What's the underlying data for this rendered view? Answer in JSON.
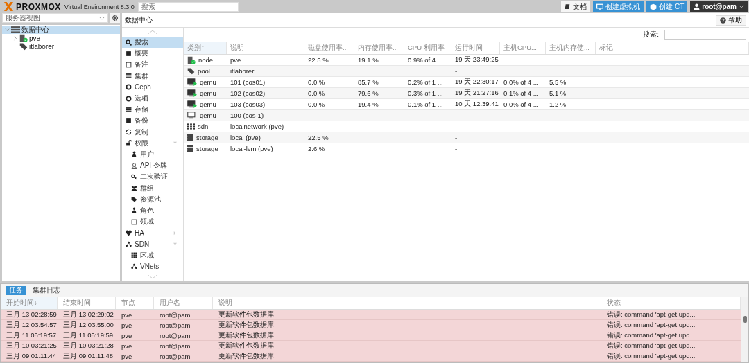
{
  "topbar": {
    "logo": "PROXMOX",
    "product": "Virtual Environment 8.3.0",
    "search": {
      "placeholder": "搜索"
    },
    "buttons": [
      {
        "label": "文档",
        "kind": "docs"
      },
      {
        "label": "创建虚拟机",
        "kind": "vm"
      },
      {
        "label": "创建 CT",
        "kind": "ct"
      },
      {
        "label": "root@pam",
        "kind": "user"
      }
    ]
  },
  "sidebar": {
    "view": "服务器视图",
    "tree": [
      {
        "label": "数据中心",
        "kind": "datacenter",
        "selected": true,
        "expanded": true,
        "children": [
          {
            "label": "pve",
            "kind": "node",
            "selected": false,
            "expanded": false
          },
          {
            "label": "itlaborer",
            "kind": "pool",
            "selected": false
          }
        ]
      }
    ]
  },
  "main": {
    "title": "数据中心",
    "help": "帮助",
    "nav": [
      {
        "label": "搜索",
        "selected": true
      },
      {
        "label": "概要",
        "selected": false
      },
      {
        "label": "备注",
        "selected": false
      },
      {
        "label": "集群",
        "selected": false
      },
      {
        "label": "Ceph",
        "selected": false
      },
      {
        "label": "选项",
        "selected": false
      },
      {
        "label": "存储",
        "selected": false
      },
      {
        "label": "备份",
        "selected": false
      },
      {
        "label": "复制",
        "selected": false
      },
      {
        "label": "权限",
        "selected": false,
        "expanded": true,
        "children": [
          {
            "label": "用户",
            "selected": false
          },
          {
            "label": "API 令牌",
            "selected": false
          },
          {
            "label": "二次验证",
            "selected": false
          },
          {
            "label": "群组",
            "selected": false
          },
          {
            "label": "资源池",
            "selected": false
          },
          {
            "label": "角色",
            "selected": false
          },
          {
            "label": "领域",
            "selected": false
          }
        ]
      },
      {
        "label": "HA",
        "selected": false,
        "expanded": false
      },
      {
        "label": "SDN",
        "selected": false,
        "expanded": true,
        "children": [
          {
            "label": "区域",
            "selected": false
          },
          {
            "label": "VNets",
            "selected": false
          }
        ]
      }
    ],
    "search_label": "搜索:",
    "table": {
      "columns": [
        {
          "label": "类别",
          "sort_mark": "↑"
        },
        {
          "label": "说明"
        },
        {
          "label": "磁盘使用率..."
        },
        {
          "label": "内存使用率..."
        },
        {
          "label": "CPU 利用率"
        },
        {
          "label": "运行时间"
        },
        {
          "label": "主机CPU..."
        },
        {
          "label": "主机内存使..."
        },
        {
          "label": "标记"
        }
      ],
      "rows": [
        {
          "kind": "node",
          "cells": [
            "node",
            "pve",
            "22.5 %",
            "19.1 %",
            "0.9% of 4 ...",
            "19 天 23:49:25",
            "",
            ""
          ]
        },
        {
          "kind": "pool",
          "cells": [
            "pool",
            "itlaborer",
            "",
            "",
            "",
            "-",
            "",
            ""
          ]
        },
        {
          "kind": "vm",
          "running": true,
          "cells": [
            "qemu",
            "101 (cos01)",
            "0.0 %",
            "85.7 %",
            "0.2% of 1 ...",
            "19 天 22:30:17",
            "0.0% of 4 ...",
            "5.5 %"
          ]
        },
        {
          "kind": "vm",
          "running": true,
          "cells": [
            "qemu",
            "102 (cos02)",
            "0.0 %",
            "79.6 %",
            "0.3% of 1 ...",
            "19 天 21:27:16",
            "0.1% of 4 ...",
            "5.1 %"
          ]
        },
        {
          "kind": "vm",
          "running": true,
          "cells": [
            "qemu",
            "103 (cos03)",
            "0.0 %",
            "19.4 %",
            "0.1% of 1 ...",
            "10 天 12:39:41",
            "0.0% of 4 ...",
            "1.2 %"
          ]
        },
        {
          "kind": "vm",
          "running": false,
          "cells": [
            "qemu",
            "100 (cos-1)",
            "",
            "",
            "",
            "-",
            "",
            ""
          ]
        },
        {
          "kind": "sdn",
          "cells": [
            "sdn",
            "localnetwork (pve)",
            "",
            "",
            "",
            "-",
            "",
            ""
          ]
        },
        {
          "kind": "storage",
          "cells": [
            "storage",
            "local (pve)",
            "22.5 %",
            "",
            "",
            "-",
            "",
            ""
          ]
        },
        {
          "kind": "storage",
          "cells": [
            "storage",
            "local-lvm (pve)",
            "2.6 %",
            "",
            "",
            "-",
            "",
            ""
          ]
        }
      ]
    }
  },
  "log": {
    "tabs": [
      {
        "label": "任务",
        "selected": true
      },
      {
        "label": "集群日志",
        "selected": false
      }
    ],
    "columns": [
      {
        "label": "开始时间",
        "sort_mark": "↓"
      },
      {
        "label": "结束时间"
      },
      {
        "label": "节点"
      },
      {
        "label": "用户名"
      },
      {
        "label": "说明"
      },
      {
        "label": "状态"
      }
    ],
    "rows": [
      {
        "error": true,
        "cells": [
          "三月 13 02:28:59",
          "三月 13 02:29:02",
          "pve",
          "root@pam",
          "更新软件包数据库",
          "错误: command 'apt-get upd..."
        ]
      },
      {
        "error": true,
        "cells": [
          "三月 12 03:54:57",
          "三月 12 03:55:00",
          "pve",
          "root@pam",
          "更新软件包数据库",
          "错误: command 'apt-get upd..."
        ]
      },
      {
        "error": true,
        "cells": [
          "三月 11 05:19:57",
          "三月 11 05:19:59",
          "pve",
          "root@pam",
          "更新软件包数据库",
          "错误: command 'apt-get upd..."
        ]
      },
      {
        "error": true,
        "cells": [
          "三月 10 03:21:25",
          "三月 10 03:21:28",
          "pve",
          "root@pam",
          "更新软件包数据库",
          "错误: command 'apt-get upd..."
        ]
      },
      {
        "error": true,
        "cells": [
          "三月 09 01:11:44",
          "三月 09 01:11:48",
          "pve",
          "root@pam",
          "更新软件包数据库",
          "错误: command 'apt-get upd..."
        ]
      }
    ]
  }
}
